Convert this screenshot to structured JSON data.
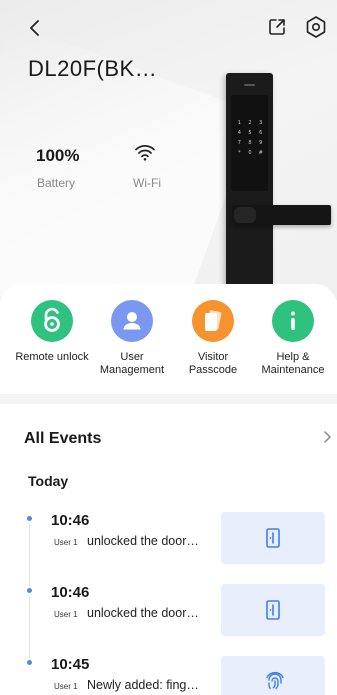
{
  "device": {
    "title": "DL20F(BK…",
    "battery": {
      "value": "100%",
      "label": "Battery"
    },
    "wifi": {
      "label": "Wi-Fi"
    },
    "keypad_keys": [
      "1",
      "2",
      "3",
      "4",
      "5",
      "6",
      "7",
      "8",
      "9",
      "*",
      "0",
      "#"
    ]
  },
  "actions": [
    {
      "label": "Remote unlock",
      "color": "#2fc27f",
      "icon": "padlock-six-icon"
    },
    {
      "label": "User Management",
      "color": "#7b98f0",
      "icon": "user-icon"
    },
    {
      "label": "Visitor Passcode",
      "color": "#f7932f",
      "icon": "cards-icon"
    },
    {
      "label": "Help & Maintenance",
      "color": "#2fc27f",
      "icon": "info-icon"
    }
  ],
  "events": {
    "header": "All Events",
    "group": "Today",
    "items": [
      {
        "time": "10:46",
        "user": "User 1",
        "text": "unlocked the door…",
        "icon": "door-icon"
      },
      {
        "time": "10:46",
        "user": "User 1",
        "text": "unlocked the door…",
        "icon": "door-icon"
      },
      {
        "time": "10:45",
        "user": "User 1",
        "text": "Newly added: fing…",
        "icon": "fingerprint-icon"
      }
    ]
  },
  "colors": {
    "accent": "#4a90e2",
    "thumb_bg": "#e8eefb"
  }
}
